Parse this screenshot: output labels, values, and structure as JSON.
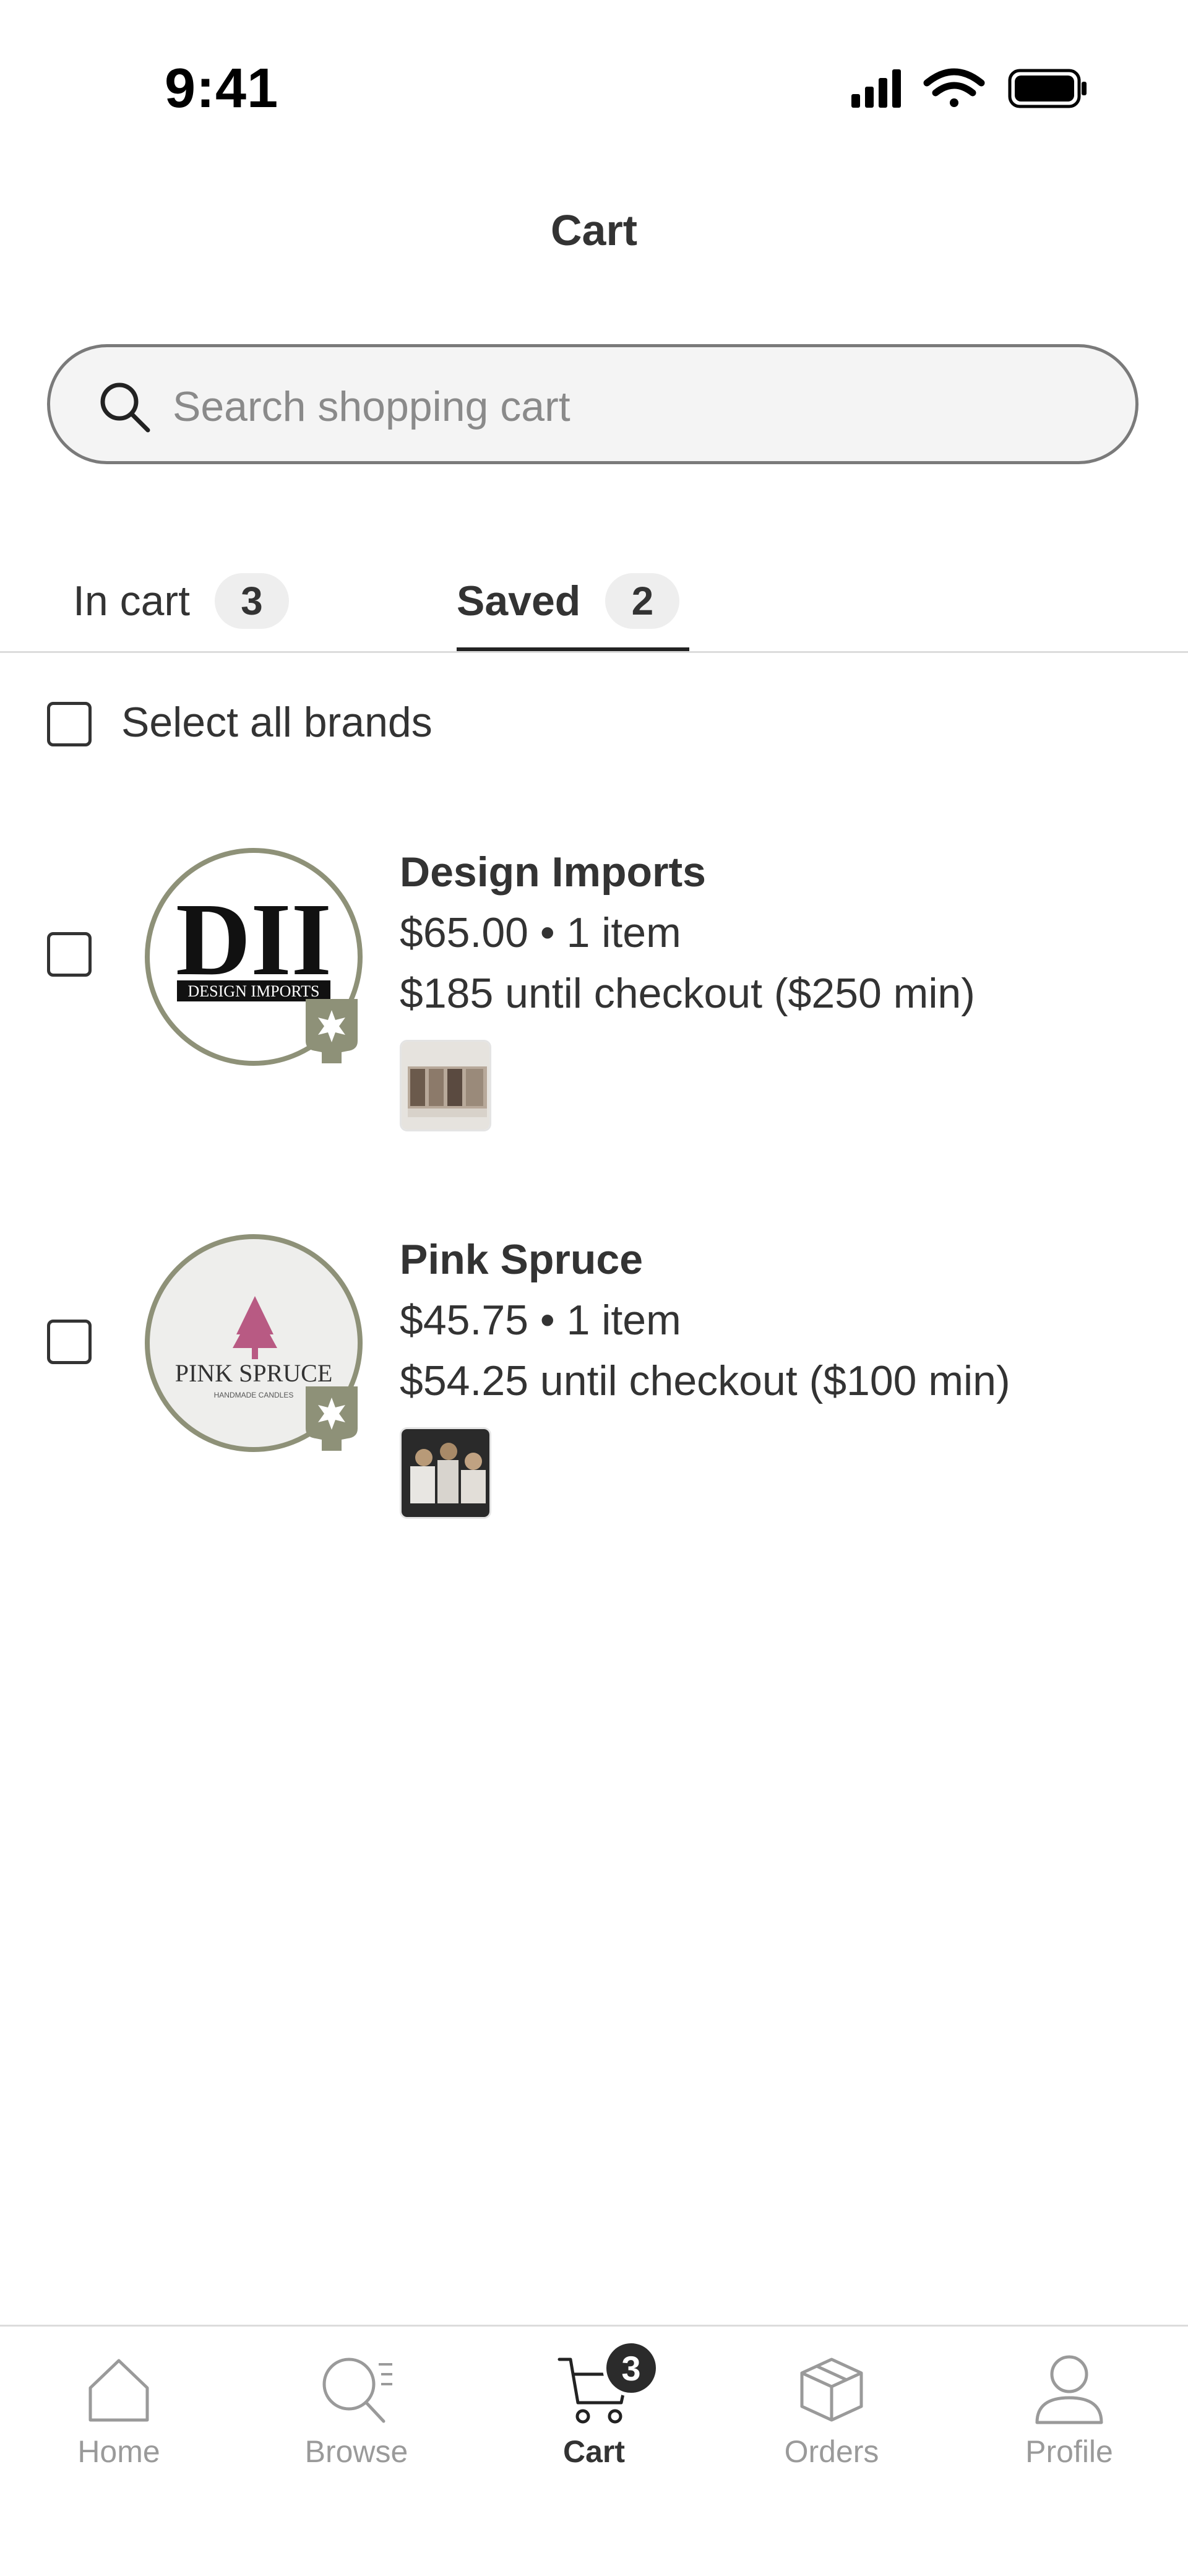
{
  "status_bar": {
    "time": "9:41"
  },
  "header": {
    "title": "Cart"
  },
  "search": {
    "placeholder": "Search shopping cart",
    "value": ""
  },
  "tabs": [
    {
      "label": "In cart",
      "count": "3",
      "active": false
    },
    {
      "label": "Saved",
      "count": "2",
      "active": true
    }
  ],
  "select_all": {
    "label": "Select all brands",
    "checked": false
  },
  "brands": [
    {
      "name": "Design Imports",
      "summary": "$65.00 • 1 item",
      "checkout_note": "$185 until checkout ($250 min)",
      "logo_text": "DII",
      "logo_subtext": "DESIGN IMPORTS",
      "checked": false
    },
    {
      "name": "Pink Spruce",
      "summary": "$45.75 • 1 item",
      "checkout_note": "$54.25 until checkout ($100 min)",
      "logo_text": "PINK SPRUCE",
      "logo_subtext": "HANDMADE CANDLES",
      "checked": false
    }
  ],
  "bottom_nav": [
    {
      "label": "Home",
      "icon": "home-icon",
      "active": false
    },
    {
      "label": "Browse",
      "icon": "browse-icon",
      "active": false
    },
    {
      "label": "Cart",
      "icon": "cart-icon",
      "active": true,
      "badge": "3"
    },
    {
      "label": "Orders",
      "icon": "box-icon",
      "active": false
    },
    {
      "label": "Profile",
      "icon": "person-icon",
      "active": false
    }
  ],
  "colors": {
    "text": "#333333",
    "muted": "#9a9a9a",
    "logo_ring": "#8e9178",
    "badge_olive": "#8e9178",
    "pink_tree": "#b85a83"
  }
}
